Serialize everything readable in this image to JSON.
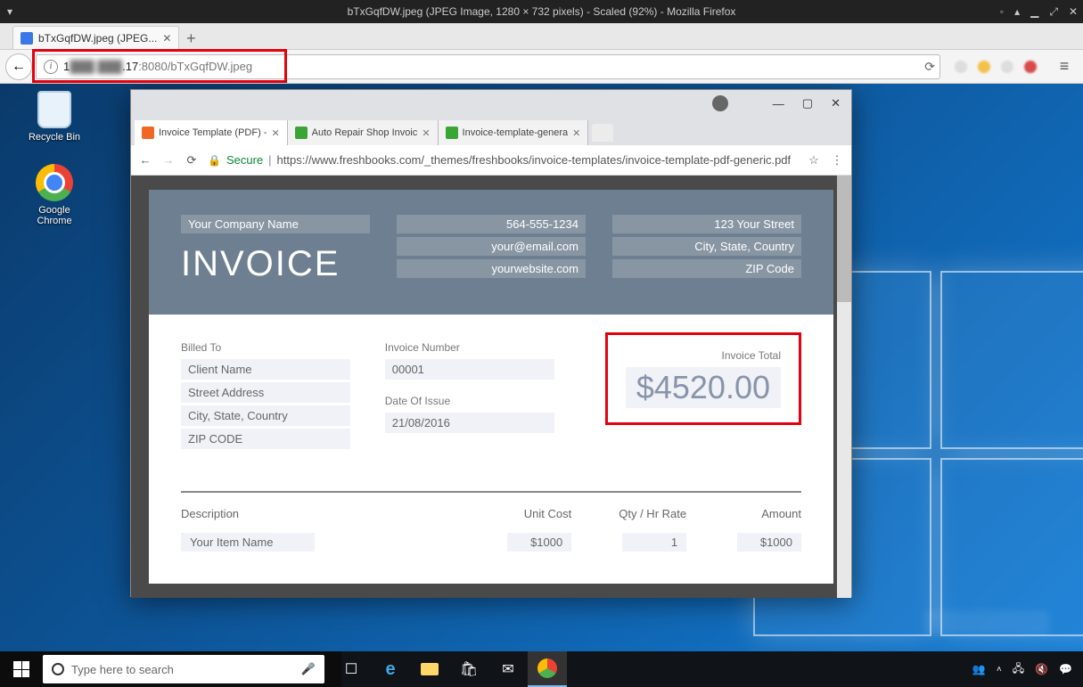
{
  "linux_titlebar": {
    "title": "bTxGqfDW.jpeg (JPEG Image, 1280 × 732 pixels) - Scaled (92%) - Mozilla Firefox"
  },
  "firefox": {
    "tab_title": "bTxGqfDW.jpeg (JPEG...",
    "url_prefix": "1",
    "url_blurred": "███ ███",
    "url_mid": ".17",
    "url_suffix": ":8080/bTxGqfDW.jpeg"
  },
  "desktop": {
    "recycle": "Recycle Bin",
    "chrome": "Google Chrome"
  },
  "chrome": {
    "sys": {
      "min": "—",
      "max": "▢",
      "close": "✕"
    },
    "tabs": [
      {
        "label": "Invoice Template (PDF) -",
        "fav_color": "#f26522"
      },
      {
        "label": "Auto Repair Shop Invoic",
        "fav_color": "#3aa535"
      },
      {
        "label": "Invoice-template-genera",
        "fav_color": "#3aa535"
      }
    ],
    "secure_label": "Secure",
    "url": "https://www.freshbooks.com/_themes/freshbooks/invoice-templates/invoice-template-pdf-generic.pdf"
  },
  "invoice": {
    "company": "Your Company Name",
    "title": "INVOICE",
    "phone": "564-555-1234",
    "email": "your@email.com",
    "website": "yourwebsite.com",
    "street": "123 Your Street",
    "csc": "City, State, Country",
    "zip": "ZIP Code",
    "billed_to_label": "Billed To",
    "client_name": "Client Name",
    "client_street": "Street Address",
    "client_csc": "City, State, Country",
    "client_zip": "ZIP CODE",
    "invoice_number_label": "Invoice Number",
    "invoice_number": "00001",
    "doi_label": "Date Of Issue",
    "doi": "21/08/2016",
    "total_label": "Invoice Total",
    "total": "$4520.00",
    "th_desc": "Description",
    "th_unit": "Unit Cost",
    "th_qty": "Qty / Hr Rate",
    "th_amt": "Amount",
    "row": {
      "desc": "Your Item Name",
      "unit": "$1000",
      "qty": "1",
      "amt": "$1000"
    }
  },
  "taskbar": {
    "search_placeholder": "Type here to search"
  }
}
